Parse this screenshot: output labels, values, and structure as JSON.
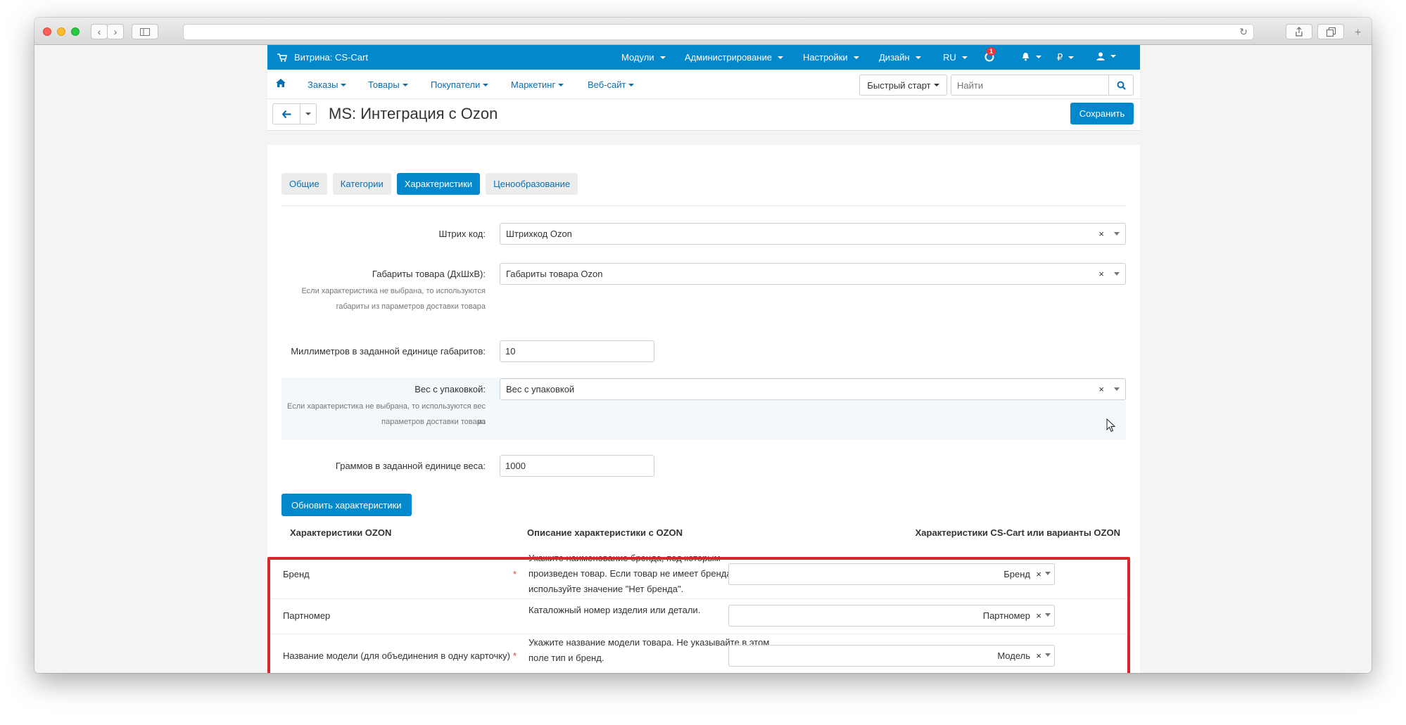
{
  "topbar": {
    "store_label": "Витрина: CS-Cart",
    "menus": [
      "Модули",
      "Администрирование",
      "Настройки",
      "Дизайн",
      "RU"
    ],
    "notification_count": "1",
    "currency": "₽"
  },
  "navbar": {
    "items": [
      "Заказы",
      "Товары",
      "Покупатели",
      "Маркетинг",
      "Веб-сайт"
    ],
    "quick_start": "Быстрый старт",
    "search_placeholder": "Найти"
  },
  "page": {
    "title": "MS: Интеграция с Ozon",
    "save_label": "Сохранить"
  },
  "tabs": [
    "Общие",
    "Категории",
    "Характеристики",
    "Ценообразование"
  ],
  "active_tab": "Характеристики",
  "form": {
    "barcode": {
      "label": "Штрих код:",
      "value": "Штрихкод Ozon"
    },
    "dimensions": {
      "label": "Габариты товара (ДхШхВ):",
      "value": "Габариты товара Ozon",
      "help_1": "Если характеристика не выбрана, то используются",
      "help_2": "габариты из параметров доставки товара"
    },
    "mm_per_unit": {
      "label": "Миллиметров в заданной единице габаритов:",
      "value": "10"
    },
    "weight": {
      "label": "Вес с упаковкой:",
      "value": "Вес с упаковкой",
      "help_1": "Если характеристика не выбрана, то используются вес из",
      "help_2": "параметров доставки товара"
    },
    "grams_per_unit": {
      "label": "Граммов в заданной единице веса:",
      "value": "1000"
    },
    "update_button": "Обновить характеристики"
  },
  "table": {
    "headers": [
      "Характеристики OZON",
      "Описание характеристики с OZON",
      "Характеристики CS-Cart или варианты OZON"
    ],
    "rows": [
      {
        "name": "Бренд",
        "required": "*",
        "desc_1": "Укажите наименование бренда, под которым",
        "desc_2": "произведен товар. Если товар не имеет бренда,",
        "desc_3": "используйте значение \"Нет бренда\".",
        "value": "Бренд"
      },
      {
        "name": "Партномер",
        "desc_1": "Каталожный номер изделия или детали.",
        "value": "Партномер"
      },
      {
        "name": "Название модели (для объединения в одну карточку)",
        "required": "*",
        "desc_1": "Укажите название модели товара. Не указывайте в этом",
        "desc_2": "поле тип и бренд.",
        "value": "Модель"
      }
    ]
  },
  "colors": {
    "brand": "#0388cc",
    "highlight_border": "#d9262c"
  }
}
